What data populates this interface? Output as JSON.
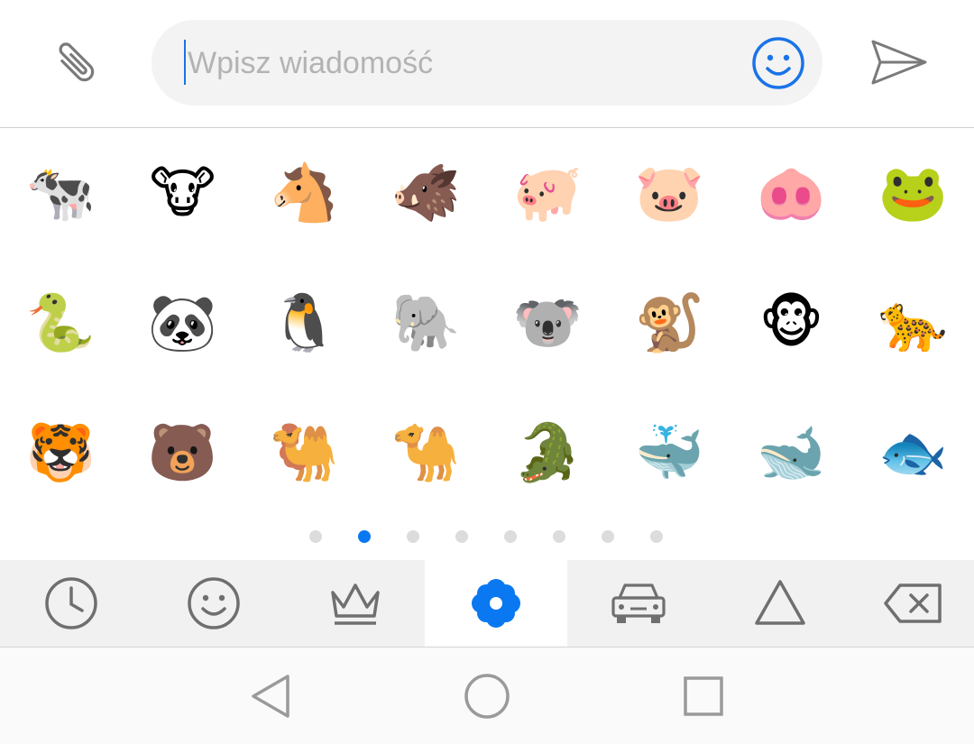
{
  "composer": {
    "attach_icon": "paperclip-icon",
    "placeholder": "Wpisz wiadomość",
    "value": "",
    "emoji_toggle_icon": "smiley-icon",
    "send_icon": "send-icon",
    "accent_color": "#1a73e8"
  },
  "emoji_grid": {
    "rows": [
      [
        "🐄",
        "🐮",
        "🐴",
        "🐗",
        "🐖",
        "🐷",
        "🐽",
        "🐸"
      ],
      [
        "🐍",
        "🐼",
        "🐧",
        "🐘",
        "🐨",
        "🐒",
        "🐵",
        "🐆"
      ],
      [
        "🐯",
        "🐻",
        "🐫",
        "🐪",
        "🐊",
        "🐳",
        "🐋",
        "🐟"
      ]
    ]
  },
  "pagination": {
    "total_pages": 8,
    "active_page": 2,
    "active_color": "#0a78f0",
    "inactive_color": "#dcdcdc"
  },
  "categories": [
    {
      "icon": "clock-icon",
      "name": "recent"
    },
    {
      "icon": "smiley-icon",
      "name": "people"
    },
    {
      "icon": "crown-icon",
      "name": "objects"
    },
    {
      "icon": "flower-icon",
      "name": "nature",
      "active": true
    },
    {
      "icon": "car-icon",
      "name": "travel"
    },
    {
      "icon": "triangle-icon",
      "name": "symbols"
    },
    {
      "icon": "backspace-icon",
      "name": "delete"
    }
  ],
  "navigation": {
    "back_icon": "back-triangle-icon",
    "home_icon": "home-circle-icon",
    "recents_icon": "recents-square-icon"
  }
}
